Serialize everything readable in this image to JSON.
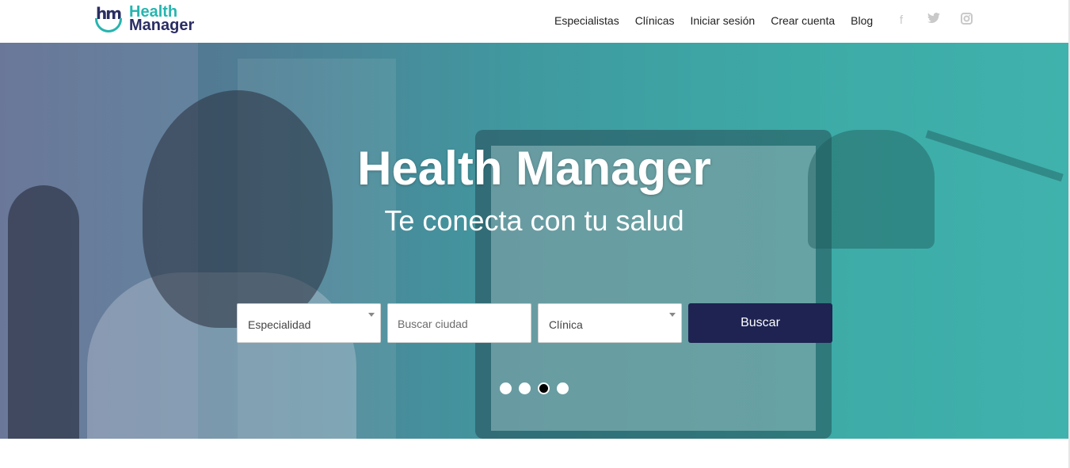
{
  "brand": {
    "line1": "Health",
    "line2": "Manager",
    "mark": "hm",
    "teal": "#27b5b0",
    "navy": "#2a2d62"
  },
  "nav": {
    "items": [
      "Especialistas",
      "Clínicas",
      "Iniciar sesión",
      "Crear cuenta",
      "Blog"
    ],
    "social": [
      {
        "name": "facebook-icon",
        "glyph": "f"
      },
      {
        "name": "twitter-icon",
        "glyph": "🐦"
      },
      {
        "name": "instagram-icon",
        "glyph": "◘"
      }
    ]
  },
  "hero": {
    "title": "Health Manager",
    "subtitle": "Te conecta con tu salud",
    "carousel": {
      "slides": 4,
      "active_index": 2
    }
  },
  "search": {
    "specialty_value": "Especialidad",
    "city_placeholder": "Buscar ciudad",
    "clinic_value": "Clínica",
    "button_label": "Buscar",
    "button_color": "#1e2352"
  }
}
